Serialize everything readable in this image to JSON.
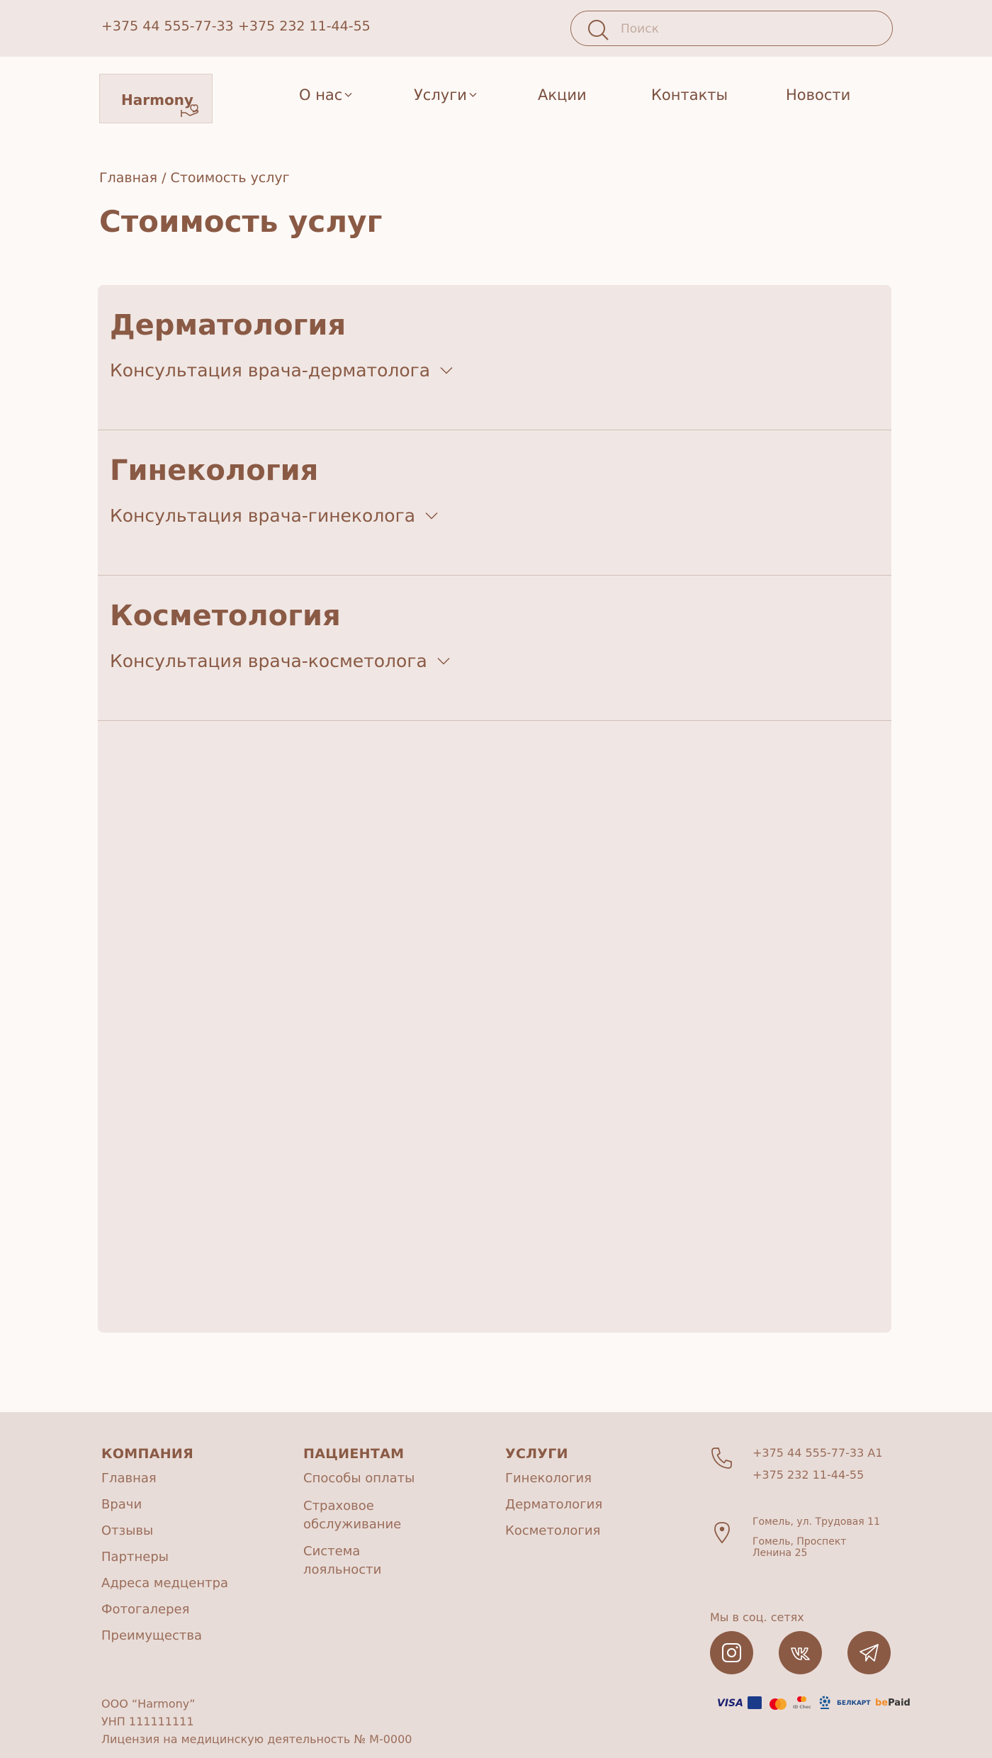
{
  "topbar": {
    "phone1": "+375 44 555-77-33",
    "phone2": "+375 232 11-44-55",
    "search_placeholder": "Поиск"
  },
  "header": {
    "logo": "Harmony",
    "nav": [
      {
        "label": "О нас",
        "has_dropdown": true
      },
      {
        "label": "Услуги",
        "has_dropdown": true
      },
      {
        "label": "Акции",
        "has_dropdown": false
      },
      {
        "label": "Контакты",
        "has_dropdown": false
      },
      {
        "label": "Новости",
        "has_dropdown": false
      }
    ]
  },
  "breadcrumb": "Главная / Стоимость услуг",
  "page_title": "Стоимость услуг",
  "sections": [
    {
      "title": "Дерматология",
      "item": "Консультация врача-дерматолога"
    },
    {
      "title": "Гинекология",
      "item": "Консультация врача-гинеколога"
    },
    {
      "title": "Косметология",
      "item": "Консультация врача-косметолога"
    }
  ],
  "footer": {
    "company": {
      "heading": "КОМПАНИЯ",
      "links": [
        "Главная",
        "Врачи",
        "Отзывы",
        "Партнеры",
        "Адреса медцентра",
        "Фотогалерея",
        "Преимущества"
      ]
    },
    "patients": {
      "heading": "ПАЦИЕНТАМ",
      "links": [
        "Способы оплаты",
        "Страховое обслуживание",
        "Система лояльности"
      ]
    },
    "services": {
      "heading": "УСЛУГИ",
      "links": [
        "Гинекология",
        "Дерматология",
        "Косметология"
      ]
    },
    "contacts": {
      "phone1": "+375 44 555-77-33 A1",
      "phone2": "+375 232 11-44-55",
      "address1": "Гомель, ул. Трудовая 11",
      "address2": "Гомель, Проспект Ленина 25"
    },
    "social_label": "Мы в соц. сетях",
    "legal": {
      "company": "ООО “Harmony”",
      "unp": "УНП 111111111",
      "license": "Лицензия на медицинскую деятельность № М-0000"
    },
    "payments": [
      "VISA",
      "BELKART",
      "Mastercard",
      "ID Check",
      "ЕРИП",
      "БЕЛКАРТ",
      "bePaid"
    ]
  },
  "colors": {
    "accent": "#8a5a45",
    "background": "#fdf9f7",
    "panel": "#f0e7e4",
    "footer": "#e8dcd8"
  }
}
